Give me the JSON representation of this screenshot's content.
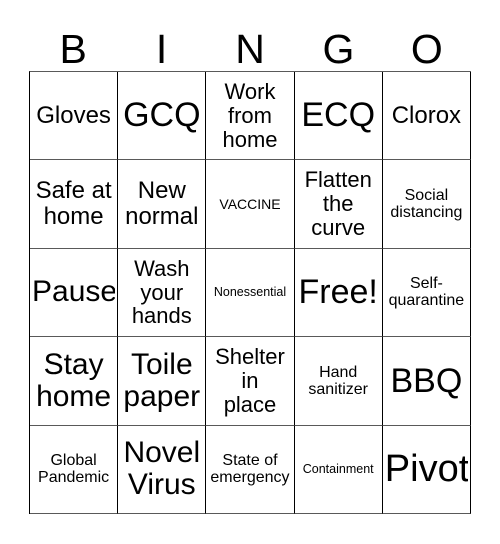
{
  "header": {
    "letters": [
      "B",
      "I",
      "N",
      "G",
      "O"
    ]
  },
  "grid": {
    "columns": 5,
    "rows": 5,
    "border_color": "#000000",
    "background_color": "#ffffff",
    "text_color": "#000000",
    "cells": [
      {
        "text": "Gloves",
        "size": "md",
        "row": 1,
        "col": 1,
        "column_letter": "B",
        "free_space": false
      },
      {
        "text": "GCQ",
        "size": "lg",
        "row": 1,
        "col": 2,
        "column_letter": "I",
        "free_space": false
      },
      {
        "text": "Work\nfrom\nhome",
        "size": "sm",
        "row": 1,
        "col": 3,
        "column_letter": "N",
        "free_space": false
      },
      {
        "text": "ECQ",
        "size": "lg",
        "row": 1,
        "col": 4,
        "column_letter": "G",
        "free_space": false
      },
      {
        "text": "Clorox",
        "size": "md",
        "row": 1,
        "col": 5,
        "column_letter": "O",
        "free_space": false
      },
      {
        "text": "Safe at\nhome",
        "size": "md",
        "row": 2,
        "col": 1,
        "column_letter": "B",
        "free_space": false
      },
      {
        "text": "New\nnormal",
        "size": "md",
        "row": 2,
        "col": 2,
        "column_letter": "I",
        "free_space": false
      },
      {
        "text": "VACCINE",
        "size": "xxs",
        "row": 2,
        "col": 3,
        "column_letter": "N",
        "free_space": false
      },
      {
        "text": "Flatten\nthe\ncurve",
        "size": "sm",
        "row": 2,
        "col": 4,
        "column_letter": "G",
        "free_space": false
      },
      {
        "text": "Social\ndistancing",
        "size": "xs",
        "row": 2,
        "col": 5,
        "column_letter": "O",
        "free_space": false
      },
      {
        "text": "Pause",
        "size": "ml",
        "row": 3,
        "col": 1,
        "column_letter": "B",
        "free_space": false
      },
      {
        "text": "Wash\nyour\nhands",
        "size": "sm",
        "row": 3,
        "col": 2,
        "column_letter": "I",
        "free_space": false
      },
      {
        "text": "Nonessential",
        "size": "tiny",
        "row": 3,
        "col": 3,
        "column_letter": "N",
        "free_space": false
      },
      {
        "text": "Free!",
        "size": "lg",
        "row": 3,
        "col": 4,
        "column_letter": "G",
        "free_space": true
      },
      {
        "text": "Self-\nquarantine",
        "size": "xs",
        "row": 3,
        "col": 5,
        "column_letter": "O",
        "free_space": false
      },
      {
        "text": "Stay\nhome",
        "size": "ml",
        "row": 4,
        "col": 1,
        "column_letter": "B",
        "free_space": false
      },
      {
        "text": "Toile\npaper",
        "size": "ml",
        "row": 4,
        "col": 2,
        "column_letter": "I",
        "free_space": false
      },
      {
        "text": "Shelter\nin\nplace",
        "size": "sm",
        "row": 4,
        "col": 3,
        "column_letter": "N",
        "free_space": false
      },
      {
        "text": "Hand\nsanitizer",
        "size": "xs",
        "row": 4,
        "col": 4,
        "column_letter": "G",
        "free_space": false
      },
      {
        "text": "BBQ",
        "size": "lg",
        "row": 4,
        "col": 5,
        "column_letter": "O",
        "free_space": false
      },
      {
        "text": "Global\nPandemic",
        "size": "xs",
        "row": 5,
        "col": 1,
        "column_letter": "B",
        "free_space": false
      },
      {
        "text": "Novel\nVirus",
        "size": "ml",
        "row": 5,
        "col": 2,
        "column_letter": "I",
        "free_space": false
      },
      {
        "text": "State of\nemergency",
        "size": "xs",
        "row": 5,
        "col": 3,
        "column_letter": "N",
        "free_space": false
      },
      {
        "text": "Containment",
        "size": "tiny",
        "row": 5,
        "col": 4,
        "column_letter": "G",
        "free_space": false
      },
      {
        "text": "Pivot",
        "size": "xl",
        "row": 5,
        "col": 5,
        "column_letter": "O",
        "free_space": false
      }
    ]
  }
}
